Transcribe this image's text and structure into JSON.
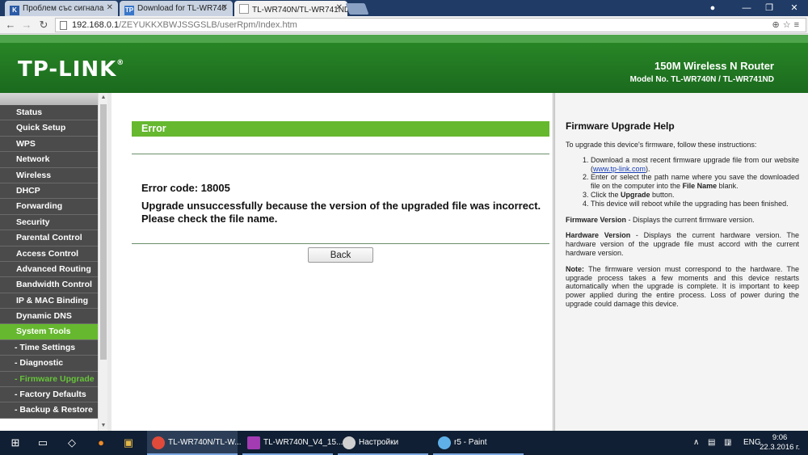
{
  "browser": {
    "tabs": [
      {
        "label": "Проблем със сигнала",
        "fav": "K",
        "fav_color": "#2b5aa6"
      },
      {
        "label": "Download for TL-WR740",
        "fav": "TP",
        "fav_color": "#3a77c9"
      },
      {
        "label": "TL-WR740N/TL-WR741ND",
        "fav": "",
        "fav_color": "#9b9b9b"
      }
    ],
    "url_host": "192.168.0.1",
    "url_path": "/ZEYUKKXBWJSSGSLB/userRpm/Index.htm"
  },
  "header": {
    "logo": "TP-LINK",
    "product": "150M Wireless N Router",
    "model": "Model No. TL-WR740N / TL-WR741ND"
  },
  "menu": {
    "items": [
      {
        "label": "Status"
      },
      {
        "label": "Quick Setup"
      },
      {
        "label": "WPS"
      },
      {
        "label": "Network"
      },
      {
        "label": "Wireless"
      },
      {
        "label": "DHCP"
      },
      {
        "label": "Forwarding"
      },
      {
        "label": "Security"
      },
      {
        "label": "Parental Control"
      },
      {
        "label": "Access Control"
      },
      {
        "label": "Advanced Routing"
      },
      {
        "label": "Bandwidth Control"
      },
      {
        "label": "IP & MAC Binding"
      },
      {
        "label": "Dynamic DNS"
      },
      {
        "label": "System Tools"
      },
      {
        "label": "- Time Settings"
      },
      {
        "label": "- Diagnostic"
      },
      {
        "label": "- Firmware Upgrade"
      },
      {
        "label": "- Factory Defaults"
      },
      {
        "label": "- Backup & Restore"
      }
    ]
  },
  "main": {
    "title": "Error",
    "error_code": "Error code: 18005",
    "message": "Upgrade unsuccessfully because the version of the upgraded file was incorrect. Please check the file name.",
    "back_label": "Back"
  },
  "help": {
    "title": "Firmware Upgrade Help",
    "intro": "To upgrade this device's firmware, follow these instructions:",
    "step1_pre": "Download a most recent firmware upgrade file from our website (",
    "step1_link": "www.tp-link.com",
    "step1_post": ").",
    "step2_pre": "Enter or select the path name where you save the downloaded file on the computer into the ",
    "step2_bold": "File Name",
    "step2_post": " blank.",
    "step3_pre": "Click the ",
    "step3_bold": "Upgrade",
    "step3_post": " button.",
    "step4": "This device will reboot while the upgrading has been finished.",
    "fw_label": "Firmware Version",
    "fw_text": " - Displays the current firmware version.",
    "hw_label": "Hardware Version",
    "hw_text": " - Displays the current hardware version. The hardware version of the upgrade file must accord with the current hardware version.",
    "note_label": "Note:",
    "note_text": " The firmware version must correspond to the hardware. The upgrade process takes a few moments and this device restarts automatically when the upgrade is complete. It is important to keep power applied during the entire process. Loss of power during the upgrade could damage this device."
  },
  "taskbar": {
    "items": [
      {
        "label": "TL-WR740N/TL-W...",
        "color": "#e04a3a"
      },
      {
        "label": "TL-WR740N_V4_15...",
        "color": "#a33bb3"
      },
      {
        "label": "Настройки",
        "color": "#cfcfcf"
      },
      {
        "label": "r5 - Paint",
        "color": "#5fb0e8"
      }
    ],
    "lang": "ENG",
    "time": "9:06",
    "date": "22.3.2016 г."
  }
}
